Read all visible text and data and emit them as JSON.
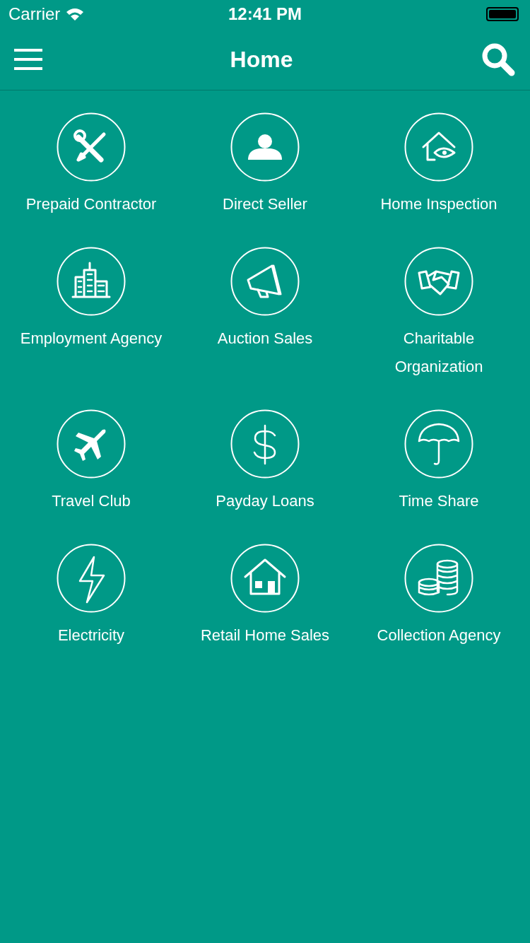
{
  "status_bar": {
    "carrier": "Carrier",
    "time": "12:41 PM"
  },
  "nav": {
    "title": "Home"
  },
  "categories": [
    {
      "label": "Prepaid Contractor",
      "kind": "tools"
    },
    {
      "label": "Direct Seller",
      "kind": "person"
    },
    {
      "label": "Home Inspection",
      "kind": "inspection"
    },
    {
      "label": "Employment Agency",
      "kind": "buildings"
    },
    {
      "label": "Auction Sales",
      "kind": "megaphone"
    },
    {
      "label": "Charitable Organization",
      "kind": "handshake"
    },
    {
      "label": "Travel Club",
      "kind": "airplane"
    },
    {
      "label": "Payday Loans",
      "kind": "dollar"
    },
    {
      "label": "Time Share",
      "kind": "umbrella"
    },
    {
      "label": "Electricity",
      "kind": "lightning"
    },
    {
      "label": "Retail Home Sales",
      "kind": "house"
    },
    {
      "label": "Collection Agency",
      "kind": "coins"
    }
  ]
}
